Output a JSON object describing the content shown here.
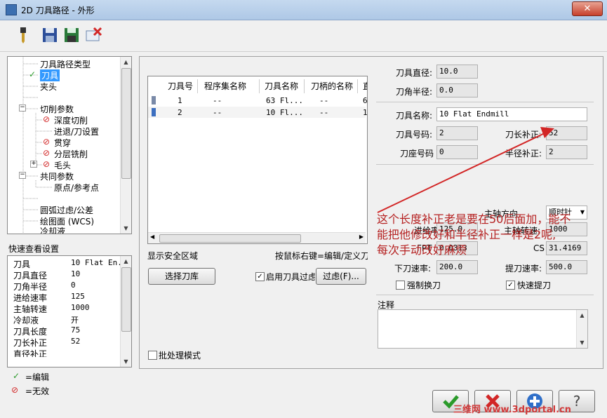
{
  "window": {
    "title": "2D 刀具路径 - 外形",
    "close_label": "✕"
  },
  "tree": {
    "items": [
      {
        "label": "刀具路径类型",
        "mark": ""
      },
      {
        "label": "刀具",
        "mark": "✓"
      },
      {
        "label": "夹头",
        "mark": ""
      },
      {
        "label": "切削参数",
        "mark": ""
      },
      {
        "label": "深度切削",
        "mark": "⊘"
      },
      {
        "label": "进退/刀设置",
        "mark": ""
      },
      {
        "label": "贯穿",
        "mark": "⊘"
      },
      {
        "label": "分层铣削",
        "mark": "⊘"
      },
      {
        "label": "毛头",
        "mark": "⊘"
      },
      {
        "label": "共同参数",
        "mark": ""
      },
      {
        "label": "原点/参考点",
        "mark": ""
      },
      {
        "label": "圆弧过虑/公差",
        "mark": ""
      },
      {
        "label": "绘图面 (WCS)",
        "mark": ""
      },
      {
        "label": "冷却液",
        "mark": ""
      }
    ]
  },
  "quick_view": {
    "title": "快速查看设置",
    "rows": [
      {
        "k": "刀具",
        "v": "10 Flat En..."
      },
      {
        "k": "刀具直径",
        "v": "10"
      },
      {
        "k": "刀角半径",
        "v": "0"
      },
      {
        "k": "进给速率",
        "v": "125"
      },
      {
        "k": "主轴转速",
        "v": "1000"
      },
      {
        "k": "冷却液",
        "v": "开"
      },
      {
        "k": "刀具长度",
        "v": "75"
      },
      {
        "k": "刀长补正",
        "v": "52"
      },
      {
        "k": "直径补正",
        "v": "2"
      }
    ]
  },
  "legend": {
    "edit_mark": "✓",
    "edit": "=编辑",
    "invalid_mark": "⊘",
    "invalid": "=无效"
  },
  "tool_table": {
    "headers": [
      "刀具号",
      "程序集名称",
      "刀具名称",
      "刀柄的名称",
      "直"
    ],
    "rows": [
      [
        "1",
        "--",
        "63 Fl...",
        "--",
        "6"
      ],
      [
        "2",
        "--",
        "10 Fl...",
        "--",
        "1"
      ]
    ]
  },
  "main": {
    "show_safe_zone": "显示安全区域",
    "right_click_hint": "按鼠标右键=编辑/定义刀",
    "select_library": "选择刀库",
    "enable_filter": "启用刀具过虑",
    "filter_button": "过虑(F)...",
    "batch_mode": "批处理模式"
  },
  "params": {
    "tool_diameter_label": "刀具直径:",
    "tool_diameter": "10.0",
    "corner_radius_label": "刀角半径:",
    "corner_radius": "0.0",
    "tool_name_label": "刀具名称:",
    "tool_name": "10 Flat Endmill",
    "tool_number_label": "刀具号码:",
    "tool_number": "2",
    "length_offset_label": "刀长补正:",
    "length_offset": "52",
    "holder_number_label": "刀座号码",
    "holder_number": "0",
    "dia_offset_label": "半径补正:",
    "dia_offset": "2",
    "spindle_dir_label": "主轴方向",
    "spindle_dir": "顺时针",
    "feed_rate_label": "进给率:",
    "feed_rate": "125.0",
    "spindle_speed_label": "主轴转速:",
    "spindle_speed": "1000",
    "fpt_label": "FPT",
    "fpt": "0.0313",
    "css_label": "CS",
    "css": "31.4169",
    "plunge_label": "下刀速率:",
    "plunge": "200.0",
    "retract_label": "提刀速率:",
    "retract": "500.0",
    "force_change": "强制换刀",
    "rapid_retract": "快速提刀",
    "notes_label": "注释"
  },
  "annotation": {
    "line1": "这个长度补正老是要在50后面加，能不",
    "line2": "能把他修改好和半径补正一样是2呢,",
    "line3": "每次手动改好麻烦"
  },
  "watermark": "三维网 www.3dportal.cn",
  "colors": {
    "accent_red": "#d22626",
    "ok_green": "#2a9a2a",
    "title_bar": "#b9d1ea"
  }
}
